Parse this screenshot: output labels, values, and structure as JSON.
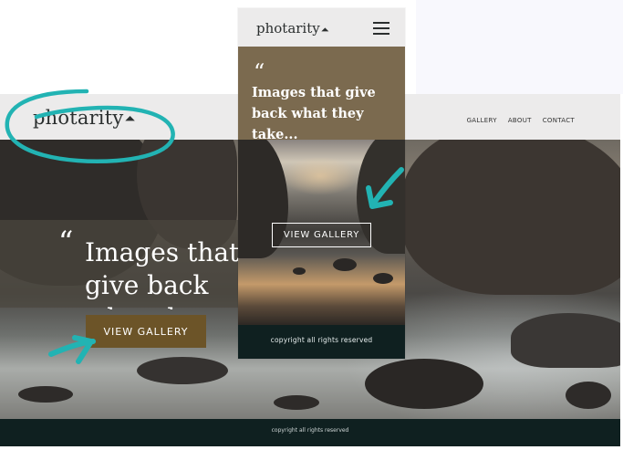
{
  "brand": {
    "name": "photarity",
    "mark": "⏶"
  },
  "desktop": {
    "nav": [
      "GALLERY",
      "ABOUT",
      "CONTACT"
    ],
    "quote_mark": "“",
    "headline": "Images that give back what they take...",
    "cta_label": "VIEW GALLERY",
    "footer_text": "copyright all rights reserved"
  },
  "mobile": {
    "quote_mark": "“",
    "headline": "Images that give back what they take...",
    "cta_label": "VIEW GALLERY",
    "footer_text": "copyright all rights reserved"
  },
  "colors": {
    "header_bg": "#ecebeb",
    "footer_bg": "#0f2020",
    "desktop_button": "#6c5428",
    "mobile_quote_bg": "#7b6a4f",
    "annotation_teal": "#22b3b3"
  },
  "icons": [
    "hamburger-menu-icon",
    "logo-chevron-icon",
    "annotation-arrow-icon"
  ]
}
